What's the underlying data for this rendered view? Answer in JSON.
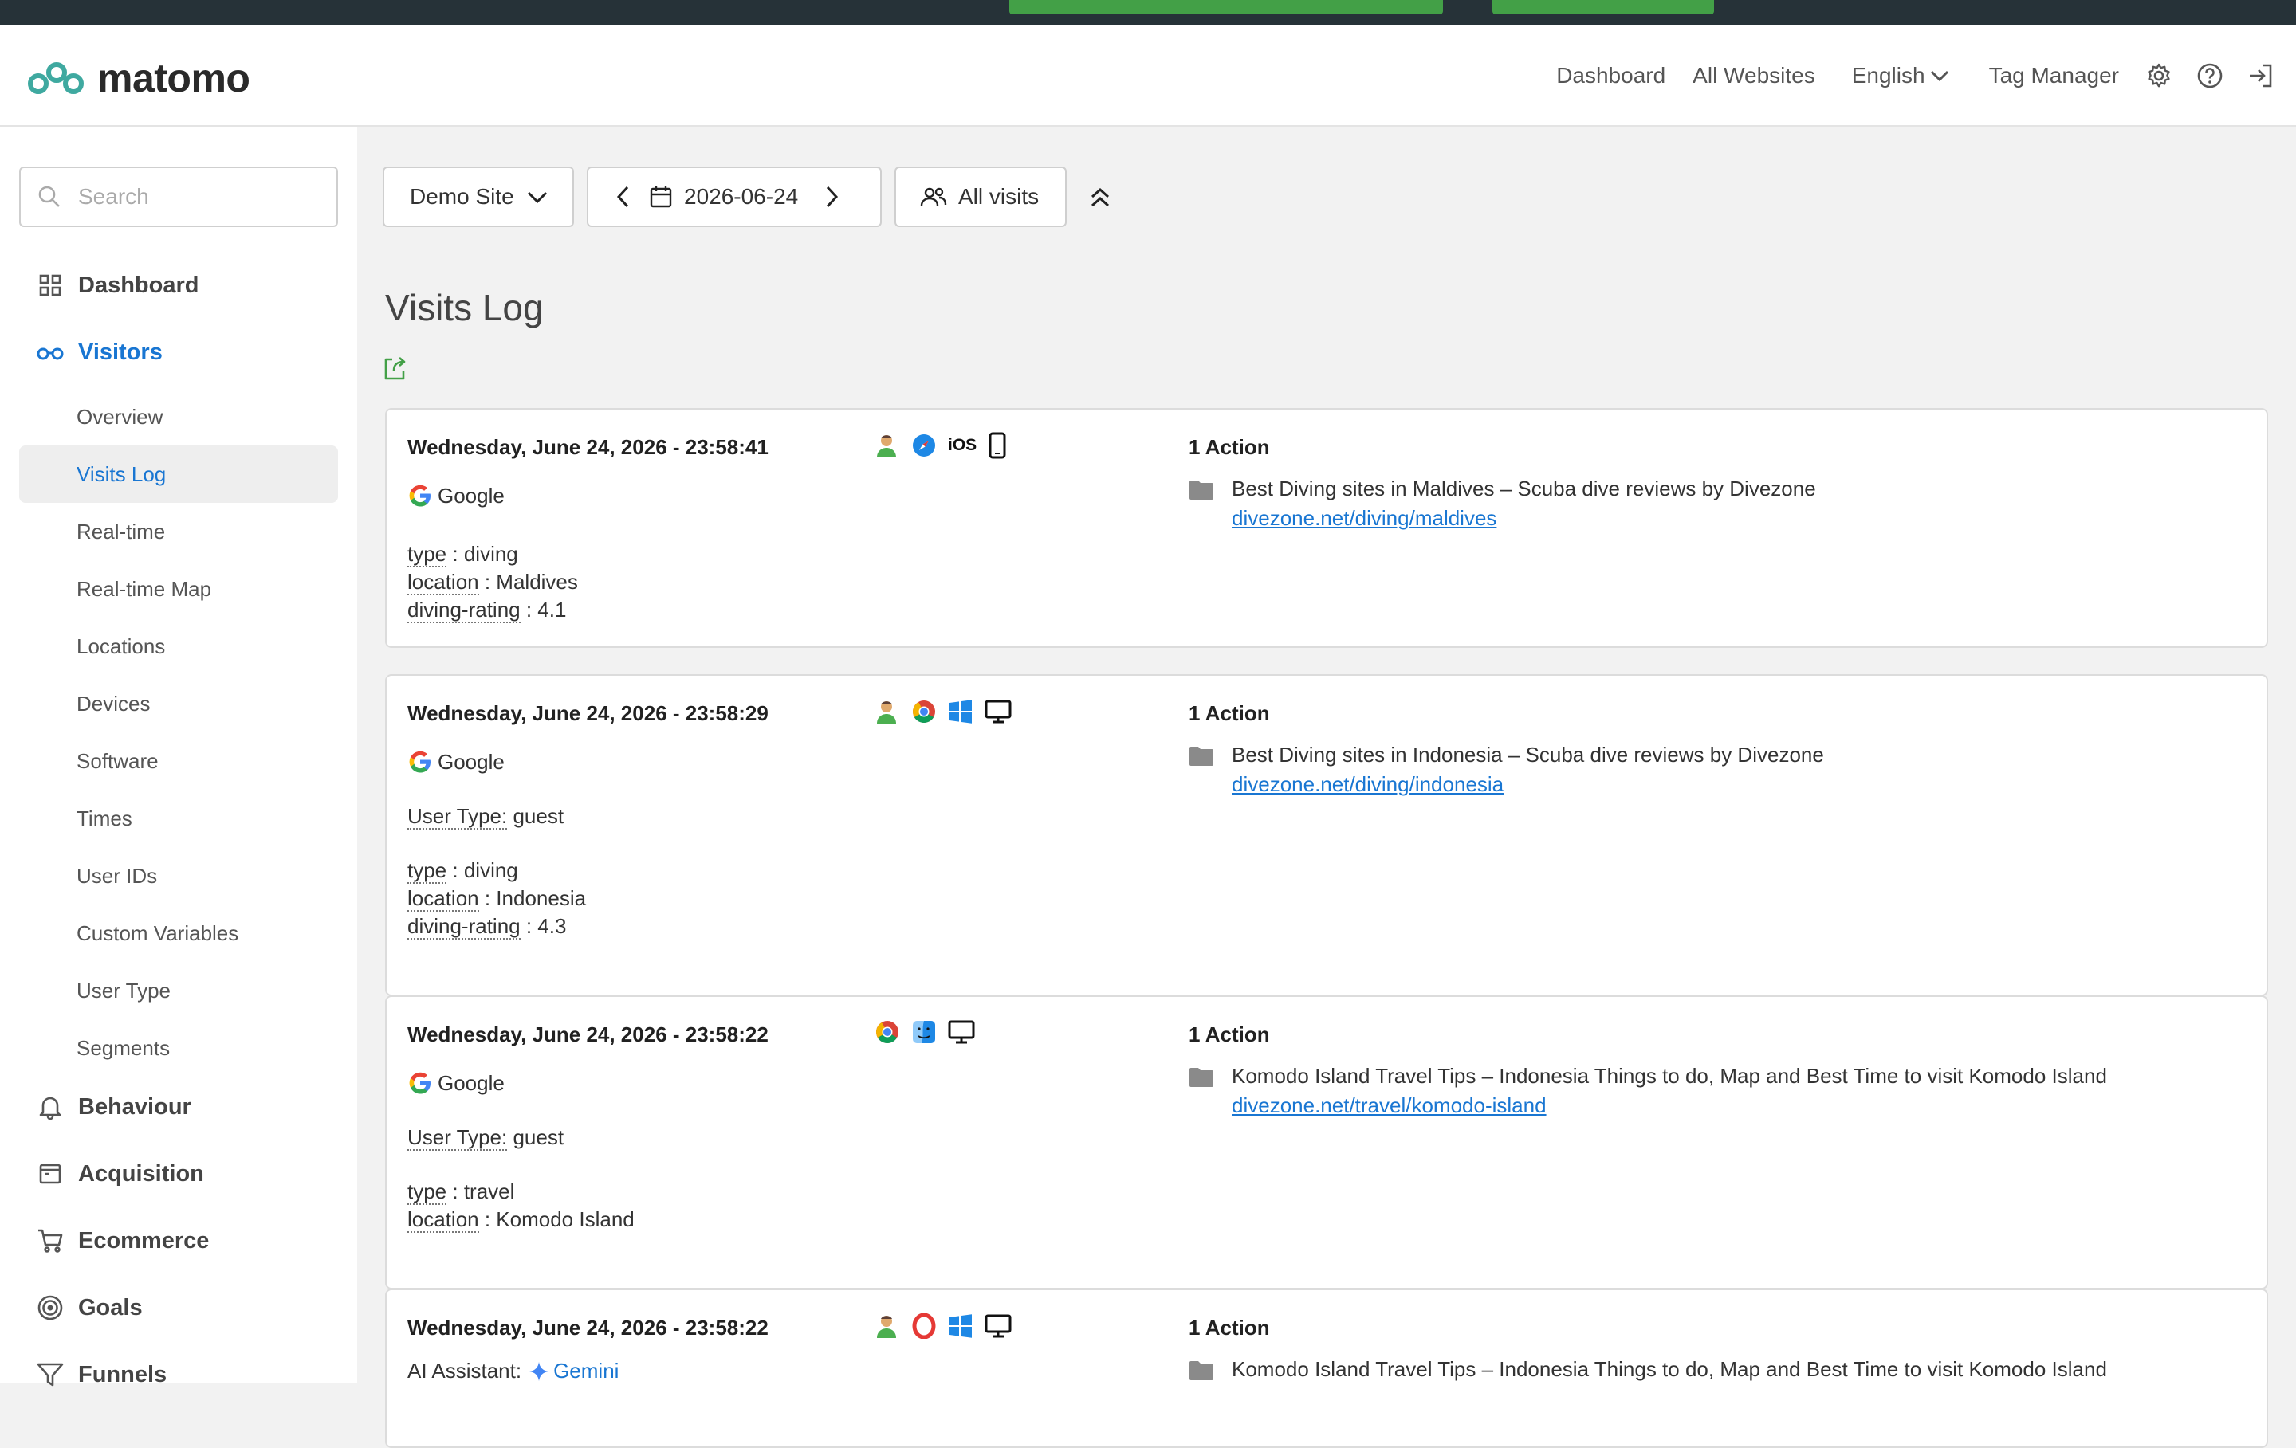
{
  "brand": {
    "name": "matomo",
    "color": "#3fa9a0"
  },
  "topnav": {
    "dashboard": "Dashboard",
    "all_websites": "All Websites",
    "language": "English",
    "tag_manager": "Tag Manager"
  },
  "search": {
    "placeholder": "Search"
  },
  "sidebar": {
    "dashboard": "Dashboard",
    "visitors": "Visitors",
    "sub": [
      "Overview",
      "Visits Log",
      "Real-time",
      "Real-time Map",
      "Locations",
      "Devices",
      "Software",
      "Times",
      "User IDs",
      "Custom Variables",
      "User Type",
      "Segments"
    ],
    "active_sub": "Visits Log",
    "behaviour": "Behaviour",
    "acquisition": "Acquisition",
    "ecommerce": "Ecommerce",
    "goals": "Goals",
    "funnels": "Funnels"
  },
  "controls": {
    "site": "Demo Site",
    "date": "2026-06-24",
    "segment": "All visits"
  },
  "page": {
    "title": "Visits Log"
  },
  "visits": [
    {
      "datetime": "Wednesday, June 24, 2026 - 23:58:41",
      "referrer": "Google",
      "os_label": "iOS",
      "vars": [
        {
          "k": "type",
          "v": " : diving"
        },
        {
          "k": "location",
          "v": " : Maldives"
        },
        {
          "k": "diving-rating",
          "v": " : 4.1"
        }
      ],
      "actions": "1 Action",
      "action_title": "Best Diving sites in Maldives – Scuba dive reviews by Divezone",
      "action_url": "divezone.net/diving/maldives"
    },
    {
      "datetime": "Wednesday, June 24, 2026 - 23:58:29",
      "referrer": "Google",
      "user_type_key": "User Type:",
      "user_type_val": " guest",
      "vars": [
        {
          "k": "type",
          "v": " : diving"
        },
        {
          "k": "location",
          "v": " : Indonesia"
        },
        {
          "k": "diving-rating",
          "v": " : 4.3"
        }
      ],
      "actions": "1 Action",
      "action_title": "Best Diving sites in Indonesia – Scuba dive reviews by Divezone",
      "action_url": "divezone.net/diving/indonesia"
    },
    {
      "datetime": "Wednesday, June 24, 2026 - 23:58:22",
      "referrer": "Google",
      "user_type_key": "User Type:",
      "user_type_val": " guest",
      "vars": [
        {
          "k": "type",
          "v": " : travel"
        },
        {
          "k": "location",
          "v": " : Komodo Island"
        }
      ],
      "actions": "1 Action",
      "action_title": "Komodo Island Travel Tips – Indonesia Things to do, Map and Best Time to visit Komodo Island",
      "action_url": "divezone.net/travel/komodo-island"
    },
    {
      "datetime": "Wednesday, June 24, 2026 - 23:58:22",
      "ai_key": "AI Assistant:",
      "ai_val": "Gemini",
      "actions": "1 Action",
      "action_title": "Komodo Island Travel Tips – Indonesia Things to do, Map and Best Time to visit Komodo Island"
    }
  ],
  "icons": {
    "visitor": "visitor-profile-icon",
    "safari": "safari-icon",
    "chrome": "chrome-icon",
    "opera": "opera-icon",
    "windows": "windows-icon",
    "mac": "mac-finder-icon",
    "desktop": "desktop-icon",
    "smartphone": "smartphone-icon",
    "folder": "folder-icon",
    "export": "export-icon"
  }
}
